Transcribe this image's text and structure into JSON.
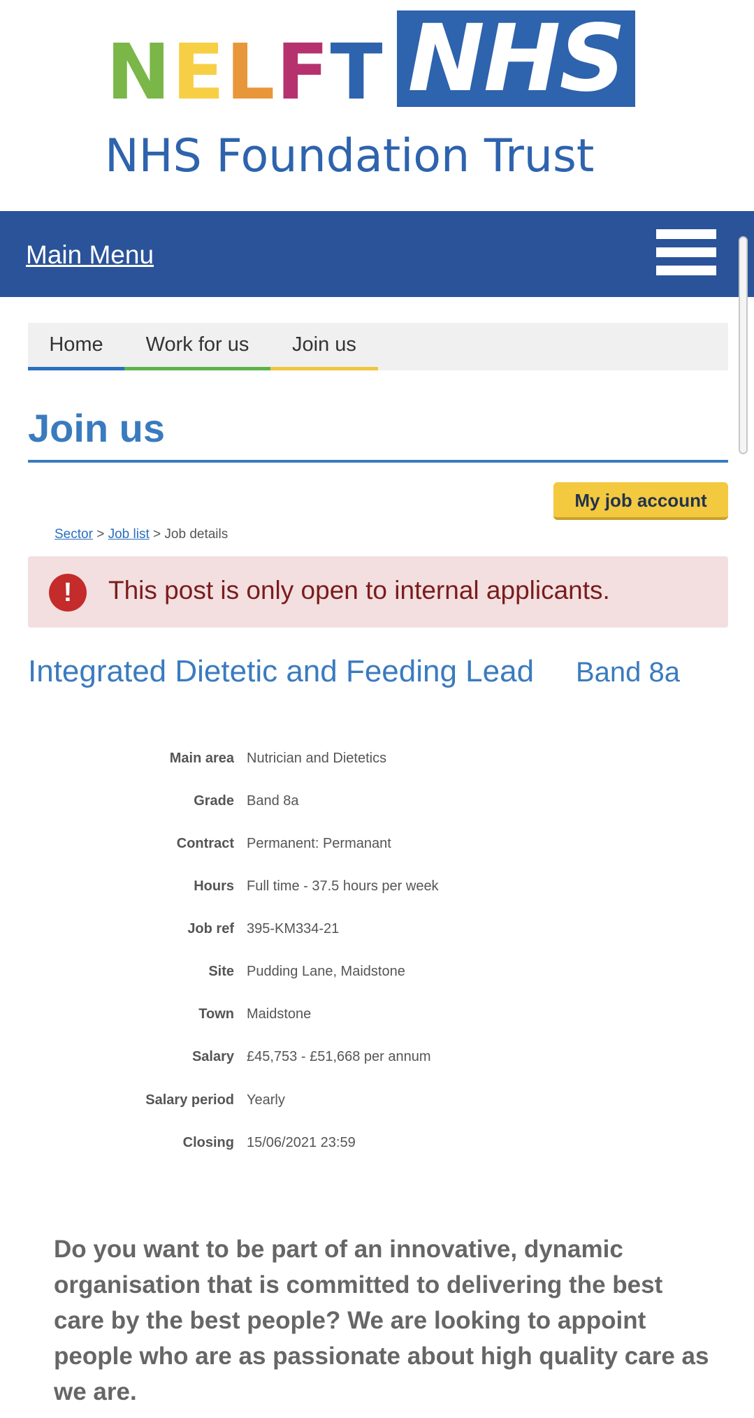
{
  "logo": {
    "nelft_letters": [
      {
        "letter": "N",
        "color": "#7ab648"
      },
      {
        "letter": "E",
        "color": "#f7cf45"
      },
      {
        "letter": "L",
        "color": "#e8963a"
      },
      {
        "letter": "F",
        "color": "#b5326f"
      },
      {
        "letter": "T",
        "color": "#2e63ad"
      }
    ],
    "nhs": "NHS",
    "trust": "NHS Foundation Trust"
  },
  "nav": {
    "main_menu": "Main Menu",
    "menu_icon": "hamburger-icon"
  },
  "tabs": [
    "Home",
    "Work for us",
    "Join us"
  ],
  "page": {
    "title": "Join us",
    "job_account_button": "My job account"
  },
  "breadcrumb": {
    "sector": "Sector",
    "sep1": ">",
    "job_list": "Job list",
    "sep2": ">",
    "current": "Job details"
  },
  "alert": {
    "icon": "alert-icon",
    "icon_glyph": "!",
    "text": "This post is only open to internal applicants."
  },
  "job": {
    "title": "Integrated Dietetic and Feeding Lead",
    "band": "Band 8a",
    "details": [
      {
        "label": "Main area",
        "value": "Nutrician and Dietetics"
      },
      {
        "label": "Grade",
        "value": "Band 8a"
      },
      {
        "label": "Contract",
        "value": "Permanent: Permanant"
      },
      {
        "label": "Hours",
        "value": "Full time - 37.5 hours per week"
      },
      {
        "label": "Job ref",
        "value": "395-KM334-21"
      },
      {
        "label": "Site",
        "value": "Pudding Lane, Maidstone"
      },
      {
        "label": "Town",
        "value": "Maidstone"
      },
      {
        "label": "Salary",
        "value": "£45,753 - £51,668 per annum"
      },
      {
        "label": "Salary period",
        "value": "Yearly"
      },
      {
        "label": "Closing",
        "value": "15/06/2021 23:59"
      }
    ],
    "intro": "Do you want to be part of an innovative, dynamic organisation that is committed to delivering the best care by the best people? We are looking to appoint people who are as passionate about high quality care as we are."
  }
}
